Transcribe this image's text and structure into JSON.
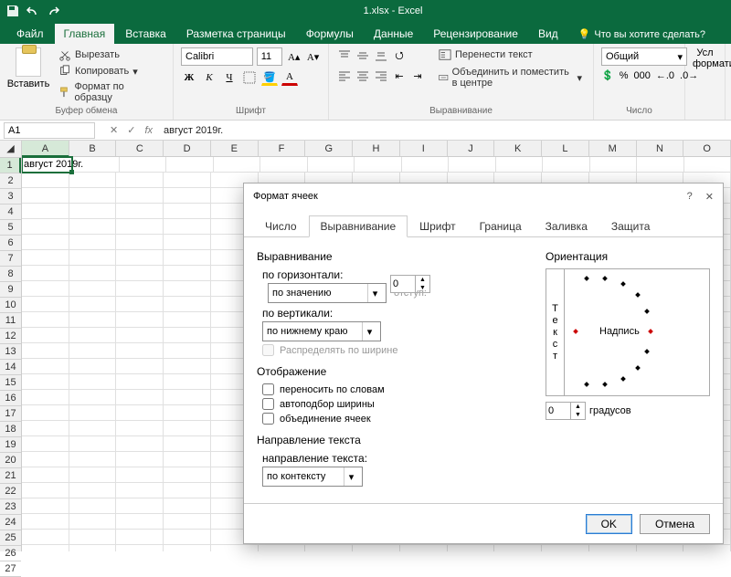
{
  "titlebar": {
    "app_title": "1.xlsx - Excel"
  },
  "tabs": {
    "file": "Файл",
    "home": "Главная",
    "insert": "Вставка",
    "layout": "Разметка страницы",
    "formulas": "Формулы",
    "data": "Данные",
    "review": "Рецензирование",
    "view": "Вид",
    "tell_me": "Что вы хотите сделать?"
  },
  "ribbon": {
    "paste": "Вставить",
    "cut": "Вырезать",
    "copy": "Копировать",
    "format_painter": "Формат по образцу",
    "clipboard": "Буфер обмена",
    "font_name": "Calibri",
    "font_size": "11",
    "font_group": "Шрифт",
    "wrap_text": "Перенести текст",
    "merge_center": "Объединить и поместить в центре",
    "alignment": "Выравнивание",
    "number_format": "Общий",
    "number_group": "Число",
    "cond_fmt": "Усл форматир"
  },
  "namebox": {
    "cell_ref": "A1",
    "formula": "август 2019г."
  },
  "grid": {
    "columns": [
      "A",
      "B",
      "C",
      "D",
      "E",
      "F",
      "G",
      "H",
      "I",
      "J",
      "K",
      "L",
      "M",
      "N",
      "O"
    ],
    "a1_value": "август 2019г.",
    "row_count": 27
  },
  "dialog": {
    "title": "Формат ячеек",
    "tabs": {
      "number": "Число",
      "alignment": "Выравнивание",
      "font": "Шрифт",
      "border": "Граница",
      "fill": "Заливка",
      "protection": "Защита"
    },
    "sect_alignment": "Выравнивание",
    "horiz_label": "по горизонтали:",
    "horiz_value": "по значению",
    "indent_label": "отступ:",
    "indent_value": "0",
    "vert_label": "по вертикали:",
    "vert_value": "по нижнему краю",
    "distribute": "Распределять по ширине",
    "sect_display": "Отображение",
    "wrap": "переносить по словам",
    "shrink": "автоподбор ширины",
    "merge": "объединение ячеек",
    "sect_textdir": "Направление текста",
    "dir_label": "направление текста:",
    "dir_value": "по контексту",
    "orient_label": "Ориентация",
    "orient_text": "Текст",
    "orient_label2": "Надпись",
    "deg_value": "0",
    "deg_label": "градусов",
    "ok": "OK",
    "cancel": "Отмена"
  }
}
